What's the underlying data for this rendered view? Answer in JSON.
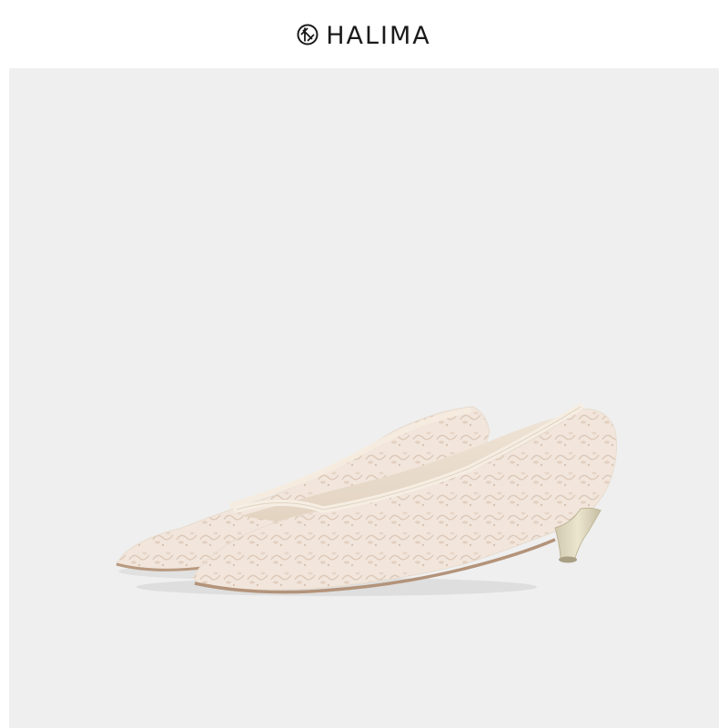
{
  "brand": {
    "name": "HALIMA",
    "logo_icon": "halima-monogram-icon"
  },
  "product_image": {
    "subject": "lace-kitten-heel-pumps",
    "colors": {
      "background": "#efefef",
      "lace": "#f1e2d6",
      "trim": "#f4eadd",
      "heel": "#d9d3b8"
    }
  }
}
